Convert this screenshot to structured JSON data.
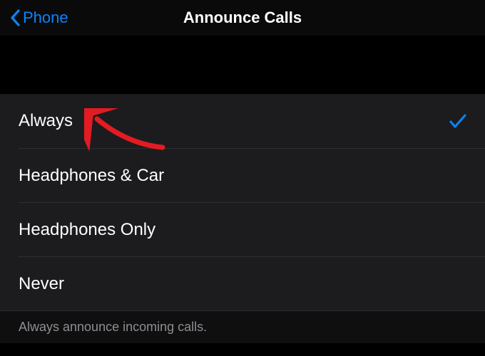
{
  "nav": {
    "back_label": "Phone",
    "title": "Announce Calls"
  },
  "options": [
    {
      "label": "Always",
      "selected": true
    },
    {
      "label": "Headphones & Car",
      "selected": false
    },
    {
      "label": "Headphones Only",
      "selected": false
    },
    {
      "label": "Never",
      "selected": false
    }
  ],
  "footer": {
    "description": "Always announce incoming calls."
  },
  "colors": {
    "accent": "#0a84ff",
    "annotation_arrow": "#e31b23"
  }
}
